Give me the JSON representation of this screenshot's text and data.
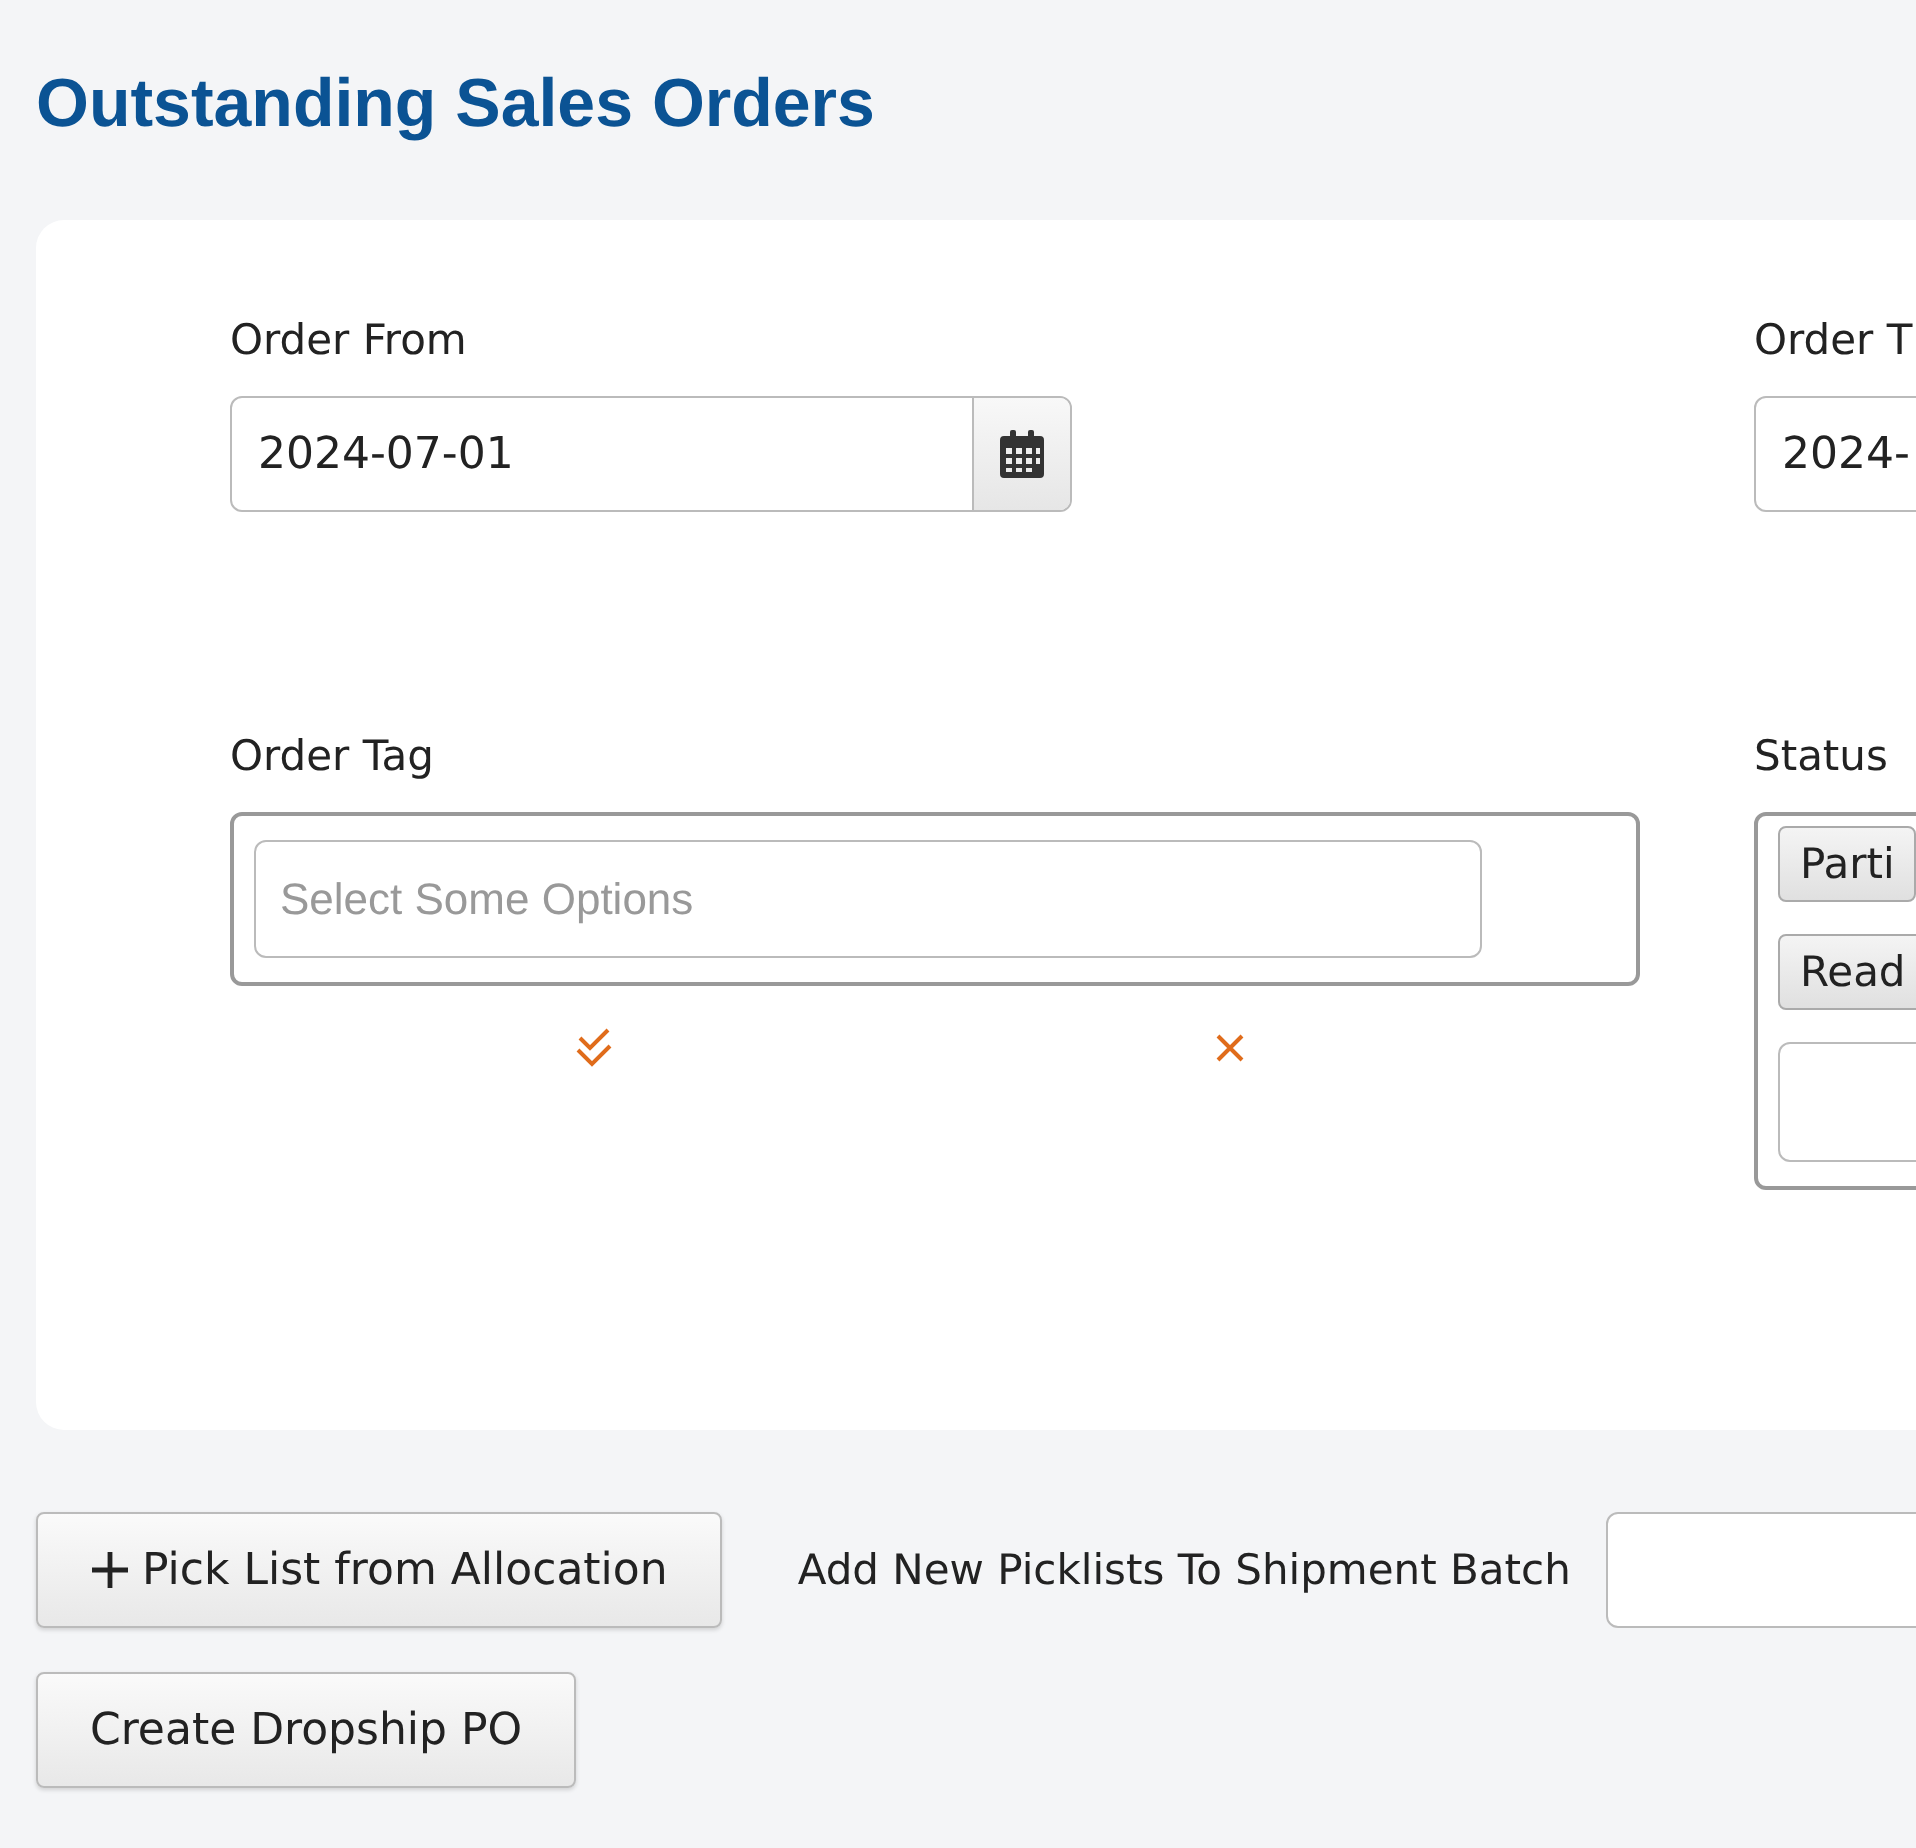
{
  "page_title": "Outstanding Sales Orders",
  "filters": [
    {
      "kind": "date",
      "label": "Order From",
      "value": "2024-07-01",
      "calendar_button": true
    },
    {
      "kind": "date",
      "label": "Order T",
      "value": "2024-"
    },
    {
      "kind": "multiselect",
      "label": "Order Tag",
      "placeholder": "Select Some Options"
    },
    {
      "kind": "multiselect",
      "label": "Status",
      "chips": [
        "Parti",
        "Read"
      ]
    }
  ],
  "pick_list_button": {
    "label": "Pick List from Allocation"
  },
  "batch_field": {
    "label": "Add New Picklists To Shipment Batch"
  },
  "dropship_button": {
    "label": "Create Dropship PO"
  }
}
